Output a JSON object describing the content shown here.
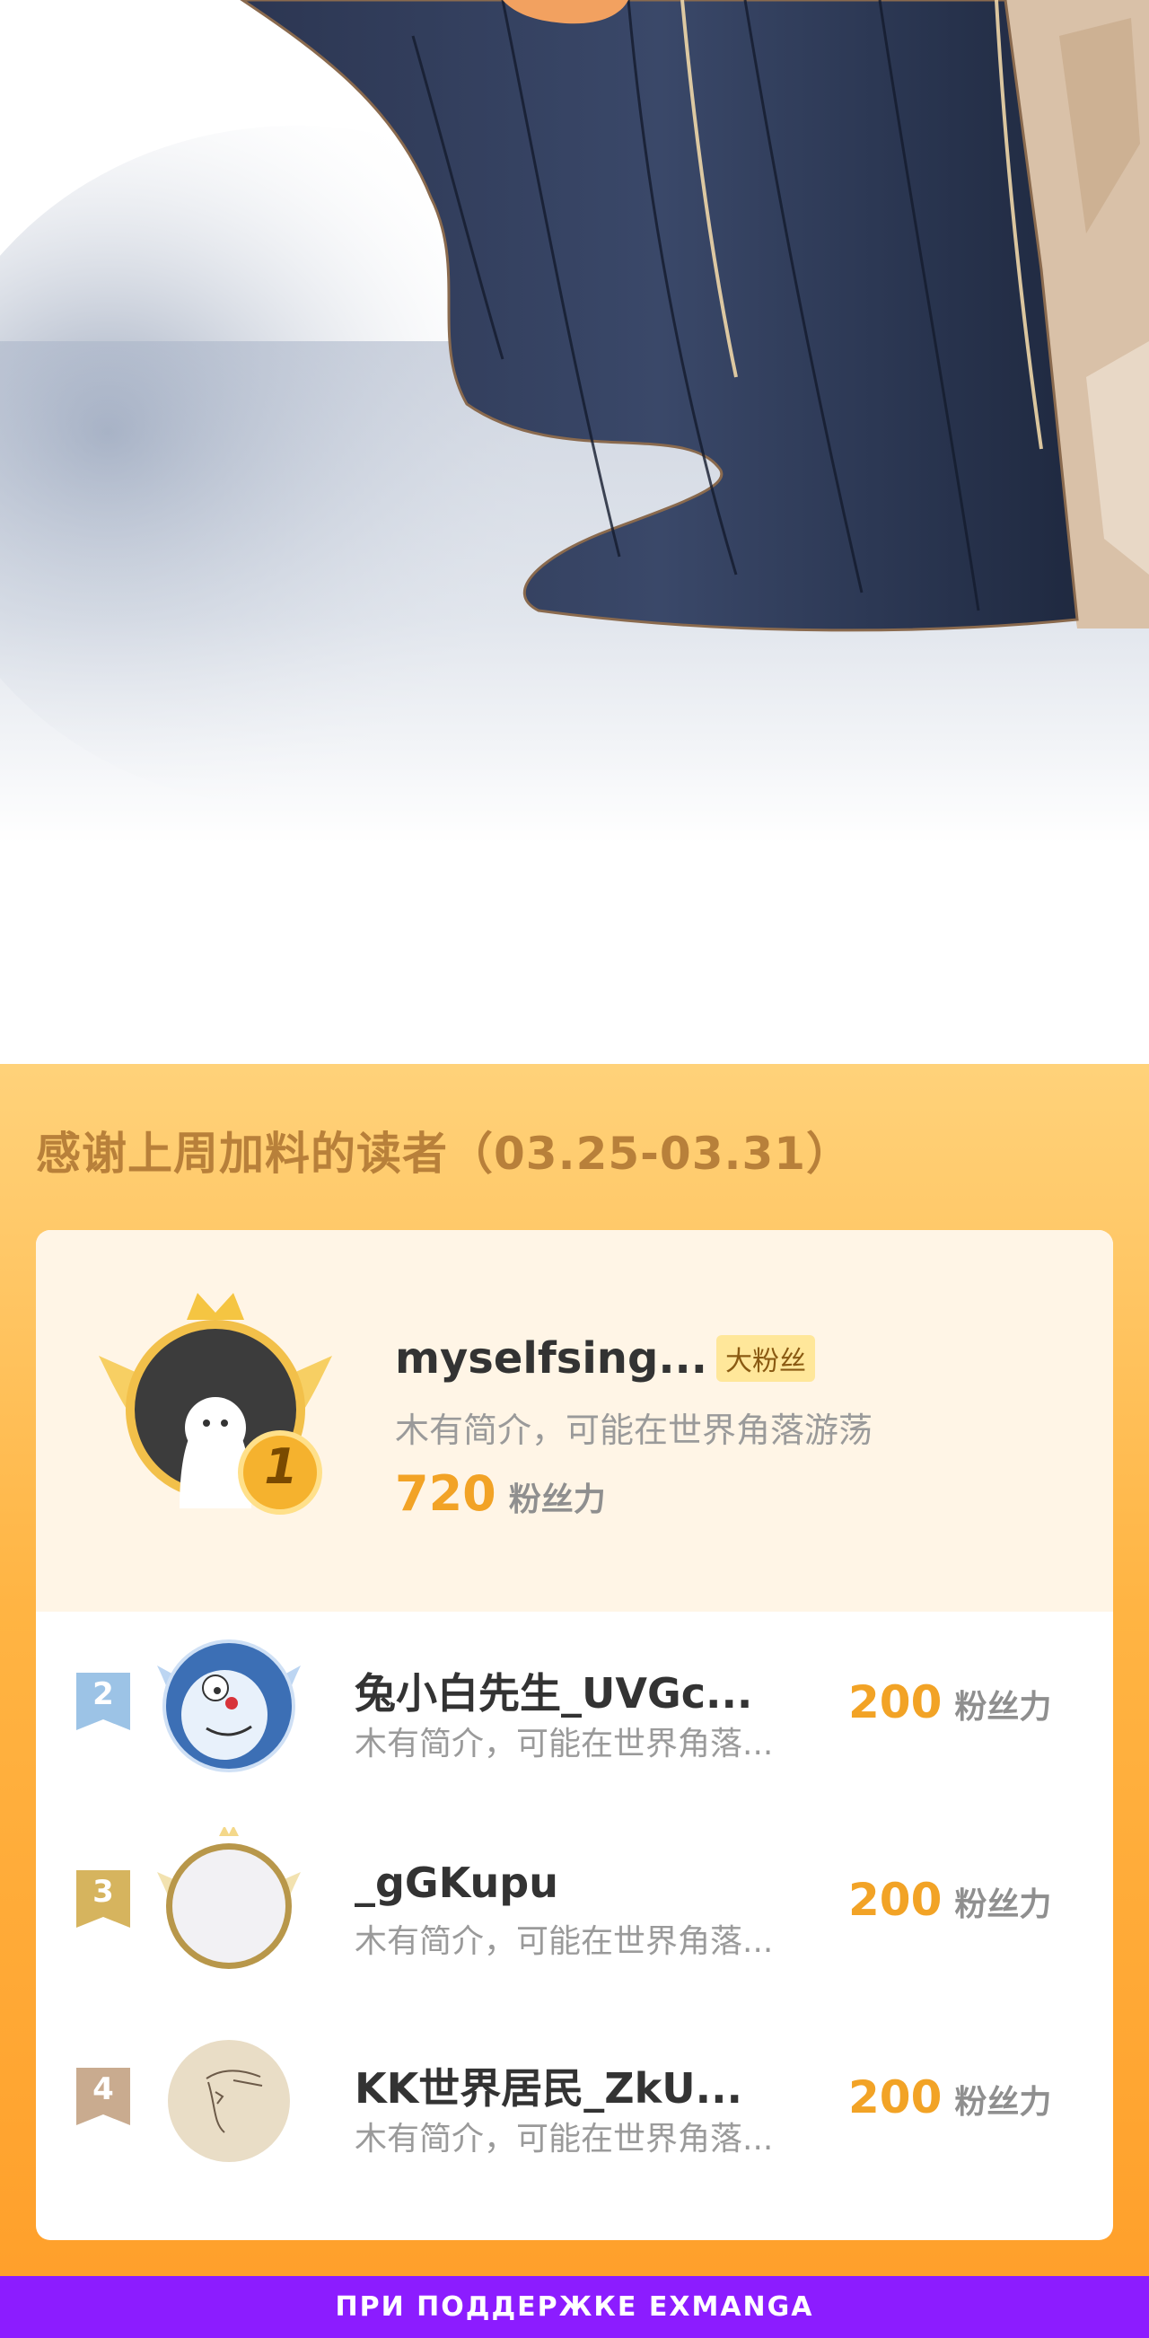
{
  "panel": {
    "title": "感谢上周加料的读者（03.25-03.31）"
  },
  "top_supporter": {
    "rank": "1",
    "name": "myselfsing...",
    "badge": "大粉丝",
    "bio": "木有简介，可能在世界角落游荡",
    "score": "720",
    "score_unit": "粉丝力"
  },
  "supporters": [
    {
      "rank": "2",
      "name": "兔小白先生_UVGc...",
      "bio": "木有简介，可能在世界角落...",
      "score": "200",
      "score_unit": "粉丝力",
      "flag_color": "#9cc3e6"
    },
    {
      "rank": "3",
      "name": "_gGKupu",
      "bio": "木有简介，可能在世界角落...",
      "score": "200",
      "score_unit": "粉丝力",
      "flag_color": "#d6b45e"
    },
    {
      "rank": "4",
      "name": "KK世界居民_ZkU...",
      "bio": "木有简介，可能在世界角落...",
      "score": "200",
      "score_unit": "粉丝力",
      "flag_color": "#c9ab8f"
    }
  ],
  "footer": {
    "text": "ПРИ ПОДДЕРЖКЕ EXMANGA"
  },
  "colors": {
    "accent": "#f2a326",
    "panel_gradient_top": "#ffd27a",
    "panel_gradient_bottom": "#ffa02b",
    "footer_bg": "#8c1cff",
    "title_text": "#b8803a"
  },
  "icons": {
    "top_avatar": "ghost-avatar-with-crown-wings",
    "rank2_avatar": "doraemon-avatar",
    "rank3_avatar": "blank-avatar-with-crown-wings",
    "rank4_avatar": "sketch-portrait-avatar",
    "rank_flag": "ribbon-flag-icon"
  }
}
